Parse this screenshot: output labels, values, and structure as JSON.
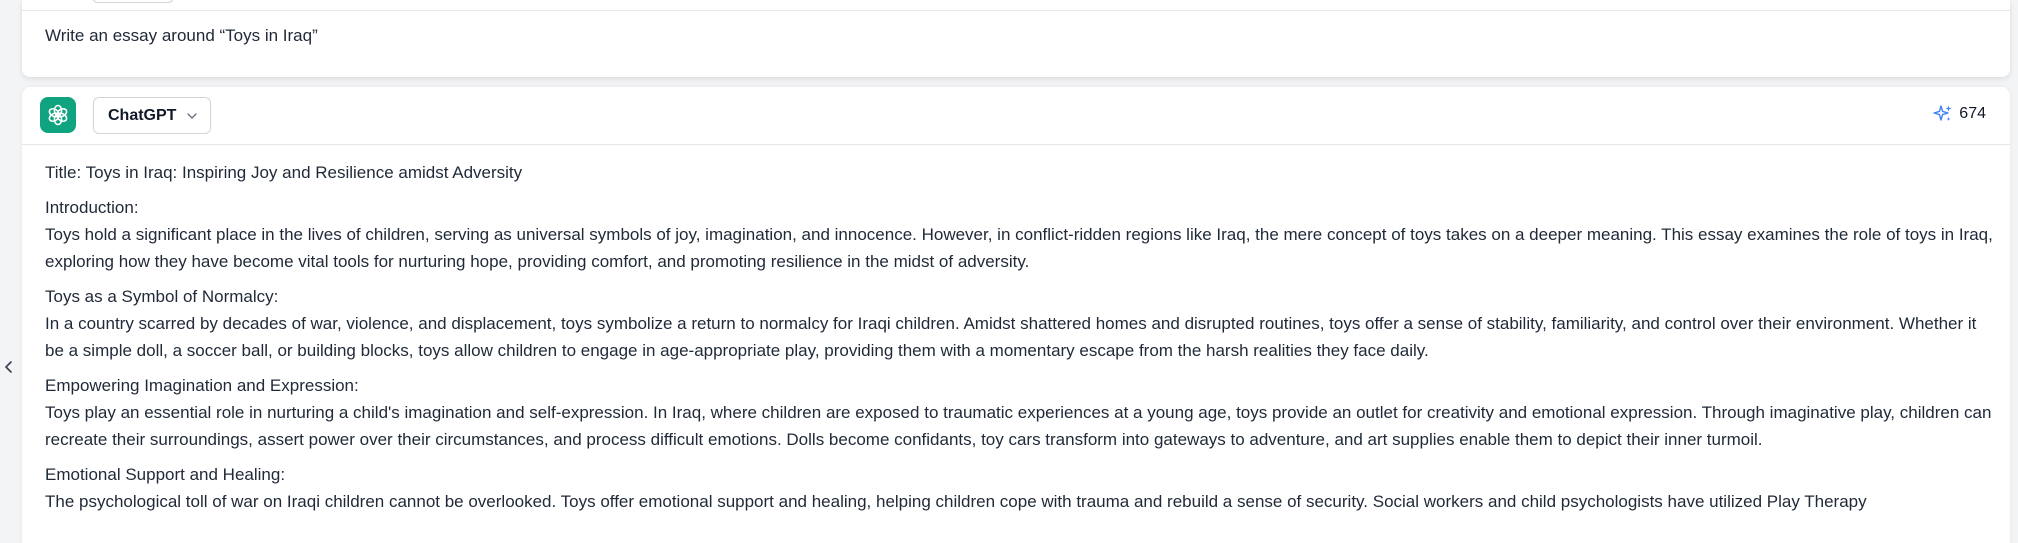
{
  "prompt": {
    "text": "Write an essay around “Toys in Iraq”"
  },
  "response": {
    "model_label": "ChatGPT",
    "token_count": "674",
    "title_line": "Title: Toys in Iraq: Inspiring Joy and Resilience amidst Adversity",
    "sections": [
      {
        "heading": "Introduction:",
        "body": "Toys hold a significant place in the lives of children, serving as universal symbols of joy, imagination, and innocence. However, in conflict-ridden regions like Iraq, the mere concept of toys takes on a deeper meaning. This essay examines the role of toys in Iraq, exploring how they have become vital tools for nurturing hope, providing comfort, and promoting resilience in the midst of adversity."
      },
      {
        "heading": "Toys as a Symbol of Normalcy:",
        "body": "In a country scarred by decades of war, violence, and displacement, toys symbolize a return to normalcy for Iraqi children. Amidst shattered homes and disrupted routines, toys offer a sense of stability, familiarity, and control over their environment. Whether it be a simple doll, a soccer ball, or building blocks, toys allow children to engage in age-appropriate play, providing them with a momentary escape from the harsh realities they face daily."
      },
      {
        "heading": "Empowering Imagination and Expression:",
        "body": "Toys play an essential role in nurturing a child's imagination and self-expression. In Iraq, where children are exposed to traumatic experiences at a young age, toys provide an outlet for creativity and emotional expression. Through imaginative play, children can recreate their surroundings, assert power over their circumstances, and process difficult emotions. Dolls become confidants, toy cars transform into gateways to adventure, and art supplies enable them to depict their inner turmoil."
      },
      {
        "heading": "Emotional Support and Healing:",
        "body": "The psychological toll of war on Iraqi children cannot be overlooked. Toys offer emotional support and healing, helping children cope with trauma and rebuild a sense of security. Social workers and child psychologists have utilized Play Therapy"
      }
    ]
  },
  "icons": {
    "logo": "chatgpt-logo-icon",
    "model_chevron": "chevron-down-icon",
    "token": "sparkle-icon",
    "sidebar": "chevron-left-icon"
  },
  "colors": {
    "brand_green": "#10a37f",
    "sparkle_blue": "#3b82f6",
    "page_bg": "#f3f4f6"
  }
}
